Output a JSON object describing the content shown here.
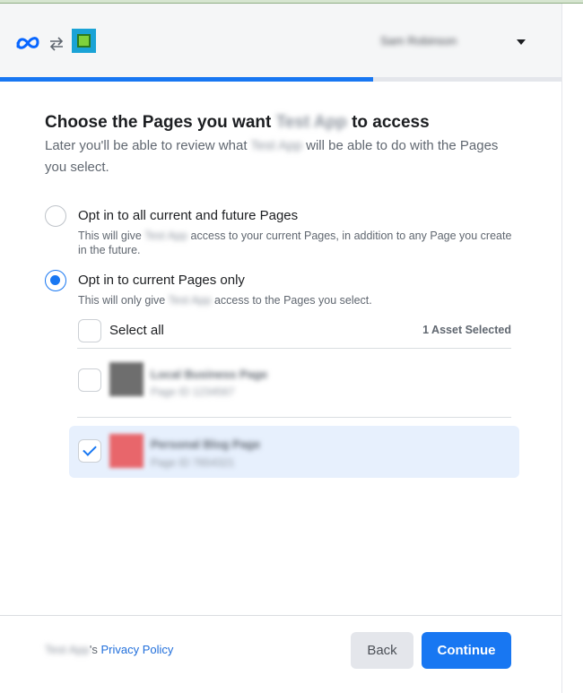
{
  "header": {
    "meta_logo_icon": "meta-infinity-icon",
    "swap_icon": "swap-arrows-icon",
    "app_logo_icon": "app-square-logo-icon",
    "account_name": "Sam Robinson",
    "dropdown_icon": "caret-down-icon"
  },
  "progress": {
    "fraction": 0.665,
    "color": "#1877f2"
  },
  "content": {
    "title_pre": "Choose the Pages you want",
    "title_app": "Test App",
    "title_post": "to access",
    "subtitle_pre": "Later you'll be able to review what",
    "subtitle_app": "Test App",
    "subtitle_post": "will be able to do with the Pages you select."
  },
  "options": [
    {
      "title": "Opt in to all current and future Pages",
      "desc_pre": "This will give",
      "desc_app": "Test App",
      "desc_post": "access to your current Pages, in addition to any Page you create in the future.",
      "selected": false
    },
    {
      "title": "Opt in to current Pages only",
      "desc_pre": "This will only give",
      "desc_app": "Test App",
      "desc_post": "access to the Pages you select.",
      "selected": true
    }
  ],
  "pages_list": {
    "select_all_label": "Select all",
    "selected_count": "1 Asset Selected",
    "pages": [
      {
        "name": "Local Business Page",
        "meta": "Page ID 1234567",
        "avatar_color": "#6e6e6e",
        "checked": false
      },
      {
        "name": "Personal Blog Page",
        "meta": "Page ID 7654321",
        "avatar_color": "#e8666b",
        "checked": true
      }
    ]
  },
  "footer": {
    "privacy_owner": "Test App",
    "privacy_suffix": "'s",
    "privacy_link": "Privacy Policy",
    "back_label": "Back",
    "continue_label": "Continue"
  },
  "colors": {
    "accent": "#1877f2",
    "selected_row": "#e7f0fd"
  }
}
